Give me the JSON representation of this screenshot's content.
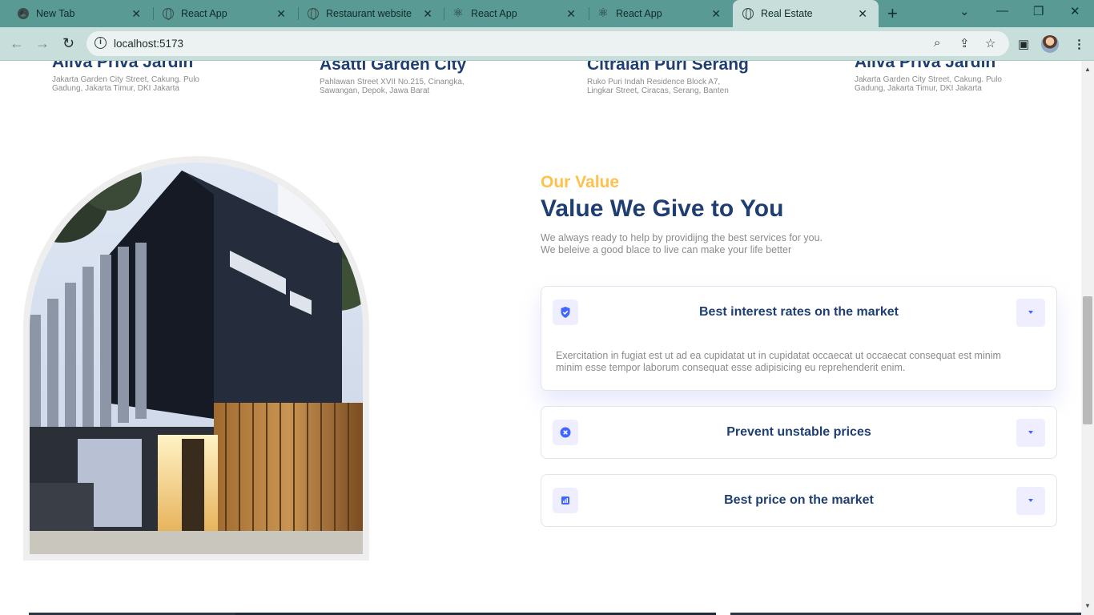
{
  "browser": {
    "tabs": [
      {
        "title": "New Tab",
        "icon": "chrome-icon"
      },
      {
        "title": "React App",
        "icon": "globe-icon"
      },
      {
        "title": "Restaurant website",
        "icon": "globe-icon"
      },
      {
        "title": "React App",
        "icon": "react-icon"
      },
      {
        "title": "React App",
        "icon": "react-icon"
      },
      {
        "title": "Real Estate",
        "icon": "globe-icon",
        "active": true
      }
    ],
    "address": "localhost:5173"
  },
  "residencies": [
    {
      "name": "Aliva Priva Jardin",
      "address": "Jakarta Garden City Street, Cakung. Pulo Gadung, Jakarta Timur, DKI Jakarta"
    },
    {
      "name": "Asatti Garden City",
      "address": "Pahlawan Street XVII No.215, Cinangka, Sawangan, Depok, Jawa Barat"
    },
    {
      "name": "Citralan Puri Serang",
      "address": "Ruko Puri Indah Residence Block A7, Lingkar Street, Ciracas, Serang, Banten"
    },
    {
      "name": "Aliva Priva Jardin",
      "address": "Jakarta Garden City Street, Cakung. Pulo Gadung, Jakarta Timur, DKI Jakarta"
    }
  ],
  "value": {
    "eyebrow": "Our Value",
    "title": "Value We Give to You",
    "desc_line1": "We always ready to help by providijng the best services for you.",
    "desc_line2": "We beleive a good blace to live can make your life better"
  },
  "accordion": [
    {
      "title": "Best interest rates on the market",
      "icon": "shield-check-icon",
      "expanded": true,
      "body": "Exercitation in fugiat est ut ad ea cupidatat ut in cupidatat occaecat ut occaecat consequat est minim minim esse tempor laborum consequat esse adipisicing eu reprehenderit enim."
    },
    {
      "title": "Prevent unstable prices",
      "icon": "x-circle-icon",
      "expanded": false
    },
    {
      "title": "Best price on the market",
      "icon": "chart-icon",
      "expanded": false
    }
  ],
  "colors": {
    "primary": "#1f3e72",
    "accent": "#fec24c",
    "blue": "#4066ff",
    "muted": "#8c8b8b"
  }
}
